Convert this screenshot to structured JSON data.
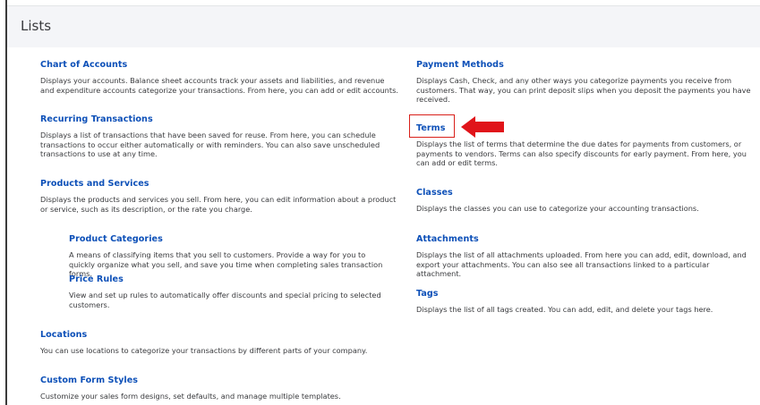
{
  "page": {
    "title": "Lists"
  },
  "left": [
    {
      "key": "chart",
      "label": "Chart of Accounts",
      "desc": "Displays your accounts. Balance sheet accounts track your assets and liabilities, and revenue and expenditure accounts categorize your transactions. From here, you can add or edit accounts."
    },
    {
      "key": "recurring",
      "label": "Recurring Transactions",
      "desc": "Displays a list of transactions that have been saved for reuse. From here, you can schedule transactions to occur either automatically or with reminders. You can also save unscheduled transactions to use at any time."
    },
    {
      "key": "products",
      "label": "Products and Services",
      "desc": "Displays the products and services you sell. From here, you can edit information about a product or service, such as its description, or the rate you charge."
    },
    {
      "key": "categories",
      "label": "Product Categories",
      "desc": "A means of classifying items that you sell to customers. Provide a way for you to quickly organize what you sell, and save you time when completing sales transaction forms."
    },
    {
      "key": "price",
      "label": "Price Rules",
      "desc": "View and set up rules to automatically offer discounts and special pricing to selected customers."
    },
    {
      "key": "locations",
      "label": "Locations",
      "desc": "You can use locations to categorize your transactions by different parts of your company."
    },
    {
      "key": "custom",
      "label": "Custom Form Styles",
      "desc": "Customize your sales form designs, set defaults, and manage multiple templates."
    }
  ],
  "right": [
    {
      "key": "payment",
      "label": "Payment Methods",
      "desc": "Displays Cash, Check, and any other ways you categorize payments you receive from customers. That way, you can print deposit slips when you deposit the payments you have received."
    },
    {
      "key": "terms",
      "label": "Terms",
      "desc": "Displays the list of terms that determine the due dates for payments from customers, or payments to vendors. Terms can also specify discounts for early payment. From here, you can add or edit terms."
    },
    {
      "key": "classes",
      "label": "Classes",
      "desc": "Displays the classes you can use to categorize your accounting transactions."
    },
    {
      "key": "attachments",
      "label": "Attachments",
      "desc": "Displays the list of all attachments uploaded. From here you can add, edit, download, and export your attachments. You can also see all transactions linked to a particular attachment."
    },
    {
      "key": "tags",
      "label": "Tags",
      "desc": "Displays the list of all tags created. You can add, edit, and delete your tags here."
    }
  ],
  "annotation": {
    "highlight_color": "#d9201a",
    "arrow_icon": "left-arrow-icon"
  },
  "colors": {
    "link": "#0d50b8",
    "text": "#393a3d",
    "header_bg": "#f4f5f8"
  }
}
